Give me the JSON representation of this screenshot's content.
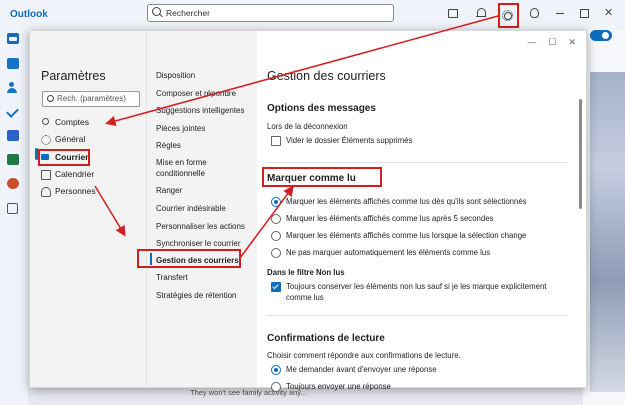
{
  "app": {
    "title": "Outlook"
  },
  "search": {
    "placeholder": "Rechercher"
  },
  "settings": {
    "title": "Paramètres",
    "search_placeholder": "Rech. (paramètres)",
    "categories": [
      {
        "label": "Comptes",
        "icon": "person-icon"
      },
      {
        "label": "Général",
        "icon": "gear-icon"
      },
      {
        "label": "Courrier",
        "icon": "mail-icon",
        "selected": true
      },
      {
        "label": "Calendrier",
        "icon": "calendar-icon"
      },
      {
        "label": "Personnes",
        "icon": "people-icon"
      }
    ],
    "subcategories": [
      "Disposition",
      "Composer et répondre",
      "Suggestions intelligentes",
      "Pièces jointes",
      "Règles",
      "Mise en forme conditionnelle",
      "Ranger",
      "Courrier indésirable",
      "Personnaliser les actions",
      "Synchroniser le courrier",
      "Gestion des courriers",
      "Transfert",
      "Stratégies de rétention"
    ],
    "selected_subcategory": "Gestion des courriers"
  },
  "content": {
    "title": "Gestion des courriers",
    "options_messages": {
      "heading": "Options des messages",
      "on_signout_label": "Lors de la déconnexion",
      "empty_deleted_label": "Vider le dossier Éléments supprimés",
      "empty_deleted_checked": false
    },
    "mark_as_read": {
      "heading": "Marquer comme lu",
      "options": [
        {
          "label": "Marquer les éléments affichés comme lus dès qu'ils sont sélectionnés",
          "selected": true
        },
        {
          "label": "Marquer les éléments affichés comme lus après 5 secondes",
          "selected": false
        },
        {
          "label": "Marquer les éléments affichés comme lus lorsque la sélection change",
          "selected": false
        },
        {
          "label": "Ne pas marquer automatiquement les éléments comme lus",
          "selected": false
        }
      ],
      "unread_filter_label": "Dans le filtre Non lus",
      "keep_unread_label": "Toujours conserver les éléments non lus sauf si je les marque explicitement comme lus",
      "keep_unread_checked": true
    },
    "read_receipts": {
      "heading": "Confirmations de lecture",
      "description": "Choisir comment répondre aux confirmations de lecture.",
      "options": [
        {
          "label": "Me demander avant d'envoyer une réponse",
          "selected": true
        },
        {
          "label": "Toujours envoyer une réponse",
          "selected": false
        }
      ]
    }
  },
  "background": {
    "bottom_text": "They won't see family activity any..."
  },
  "colors": {
    "accent": "#0f6cbd",
    "annotation_red": "#d11f1f"
  }
}
